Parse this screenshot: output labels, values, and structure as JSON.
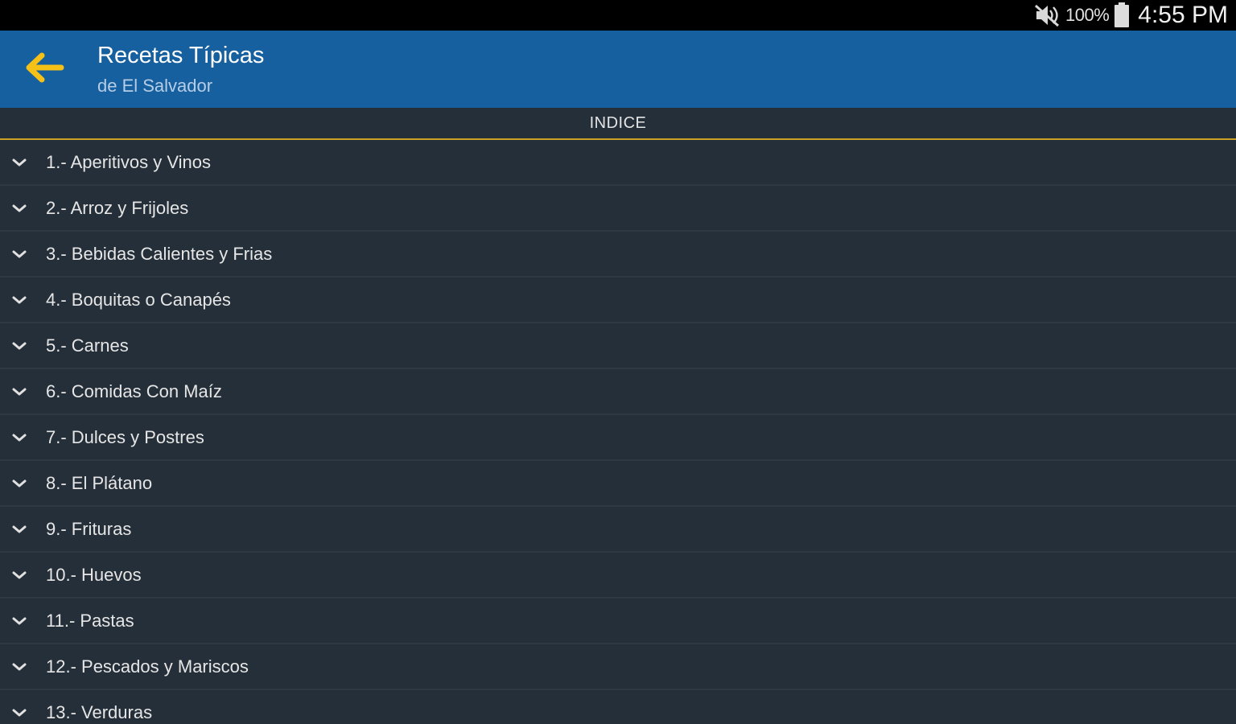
{
  "status_bar": {
    "battery": "100%",
    "time": "4:55 PM",
    "icons": [
      "mute-icon",
      "battery-icon"
    ]
  },
  "app_bar": {
    "title": "Recetas Típicas",
    "subtitle": "de El Salvador",
    "back_icon": "arrow-left-icon",
    "accent_color": "#f5c116",
    "background_color": "#1660a0"
  },
  "index": {
    "header": "INDICE",
    "divider_color": "#c9a227",
    "items": [
      {
        "label": "1.- Aperitivos y Vinos"
      },
      {
        "label": "2.- Arroz y Frijoles"
      },
      {
        "label": "3.- Bebidas Calientes y Frias"
      },
      {
        "label": "4.- Boquitas o Canapés"
      },
      {
        "label": "5.- Carnes"
      },
      {
        "label": "6.- Comidas Con Maíz"
      },
      {
        "label": "7.- Dulces y Postres"
      },
      {
        "label": "8.- El Plátano"
      },
      {
        "label": "9.- Frituras"
      },
      {
        "label": "10.- Huevos"
      },
      {
        "label": "11.- Pastas"
      },
      {
        "label": "12.- Pescados y Mariscos"
      },
      {
        "label": "13.- Verduras"
      }
    ]
  }
}
